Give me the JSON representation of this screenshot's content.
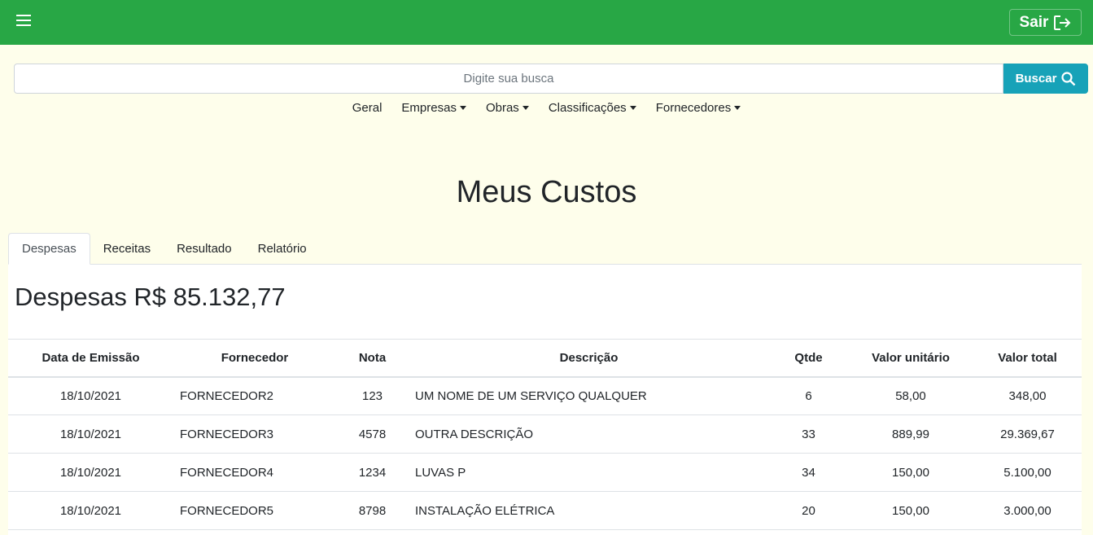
{
  "header": {
    "menu_icon": "hamburger-menu-icon",
    "logout_label": "Sair",
    "logout_icon": "logout-arrow-icon",
    "bar_color": "#28a745"
  },
  "search": {
    "placeholder": "Digite sua busca",
    "button_label": "Buscar",
    "button_icon": "search-icon",
    "button_color": "#17a2b8"
  },
  "nav": {
    "items": [
      {
        "label": "Geral",
        "dropdown": false
      },
      {
        "label": "Empresas",
        "dropdown": true
      },
      {
        "label": "Obras",
        "dropdown": true
      },
      {
        "label": "Classificações",
        "dropdown": true
      },
      {
        "label": "Fornecedores",
        "dropdown": true
      }
    ]
  },
  "page": {
    "title": "Meus Custos"
  },
  "tabs": [
    {
      "label": "Despesas",
      "active": true
    },
    {
      "label": "Receitas",
      "active": false
    },
    {
      "label": "Resultado",
      "active": false
    },
    {
      "label": "Relatório",
      "active": false
    }
  ],
  "expenses": {
    "heading": "Despesas R$ 85.132,77",
    "columns": [
      "Data de Emissão",
      "Fornecedor",
      "Nota",
      "Descrição",
      "Qtde",
      "Valor unitário",
      "Valor total"
    ],
    "rows": [
      [
        "18/10/2021",
        "FORNECEDOR2",
        "123",
        "UM NOME DE UM SERVIÇO QUALQUER",
        "6",
        "58,00",
        "348,00"
      ],
      [
        "18/10/2021",
        "FORNECEDOR3",
        "4578",
        "OUTRA DESCRIÇÃO",
        "33",
        "889,99",
        "29.369,67"
      ],
      [
        "18/10/2021",
        "FORNECEDOR4",
        "1234",
        "LUVAS P",
        "34",
        "150,00",
        "5.100,00"
      ],
      [
        "18/10/2021",
        "FORNECEDOR5",
        "8798",
        "INSTALAÇÃO ELÉTRICA",
        "20",
        "150,00",
        "3.000,00"
      ]
    ]
  }
}
